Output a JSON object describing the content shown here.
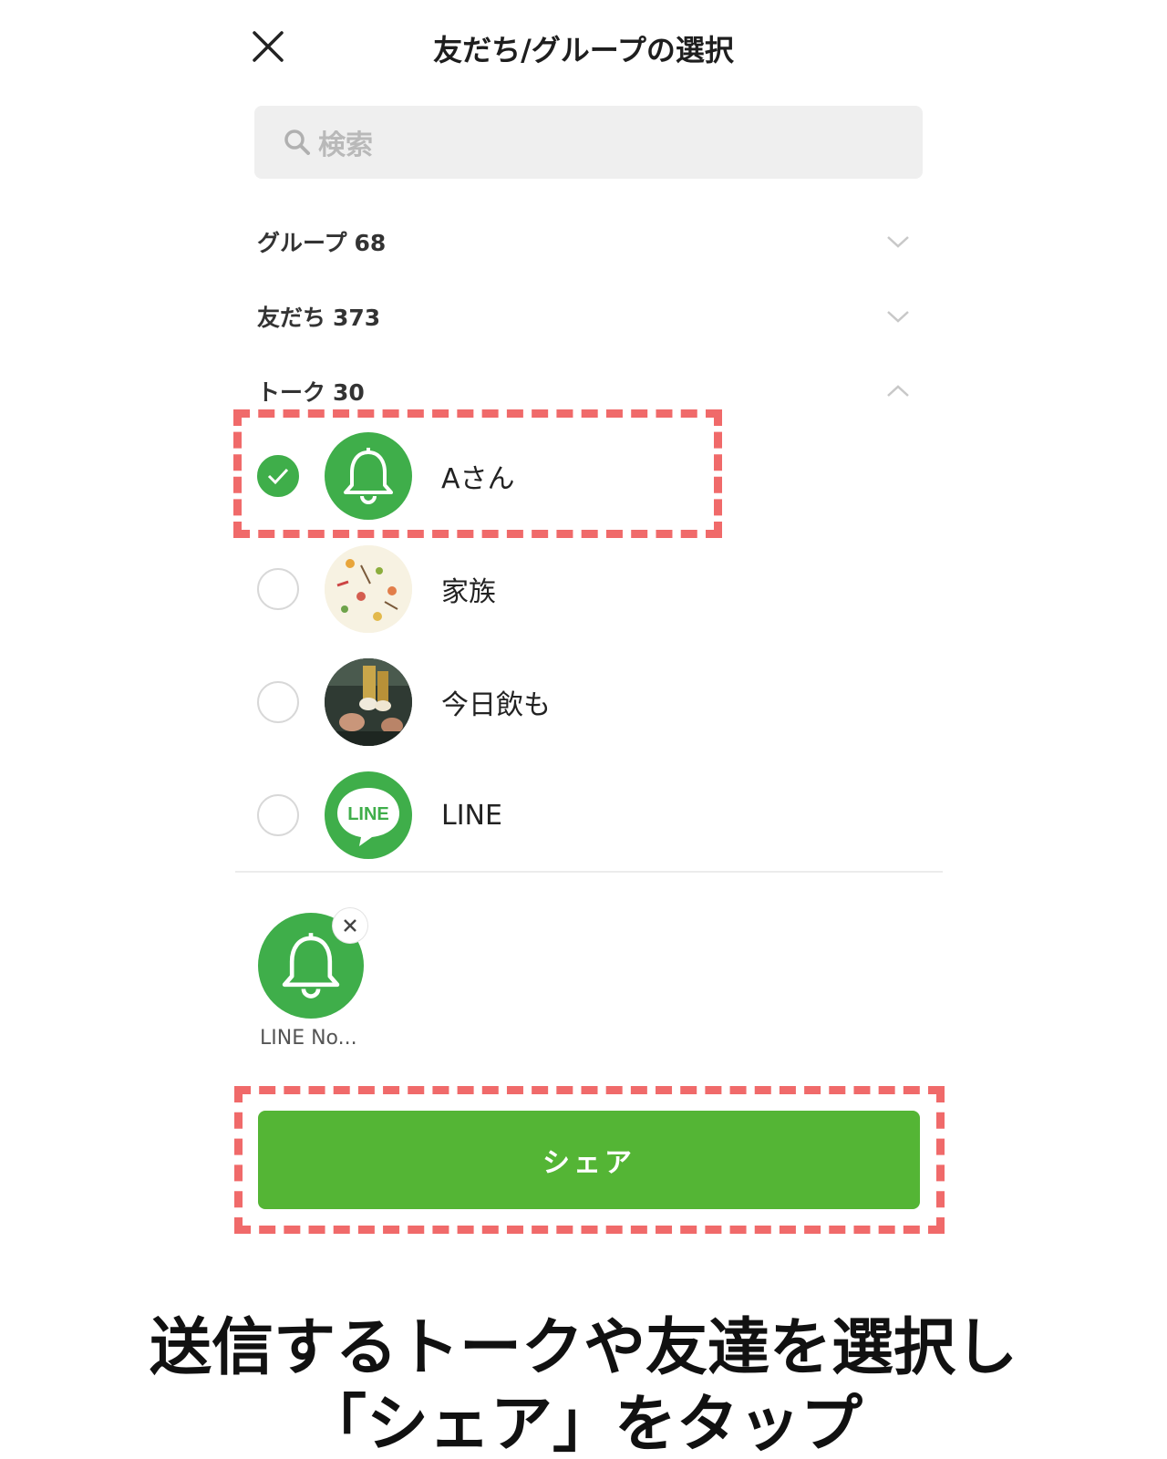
{
  "header": {
    "title": "友だち/グループの選択",
    "close_icon": "close-icon"
  },
  "search": {
    "placeholder": "検索",
    "icon": "search-icon"
  },
  "sections": [
    {
      "label": "グループ",
      "count": "68",
      "state": "collapsed"
    },
    {
      "label": "友だち",
      "count": "373",
      "state": "collapsed"
    },
    {
      "label": "トーク",
      "count": "30",
      "state": "expanded"
    }
  ],
  "talk_list": [
    {
      "name": "Aさん",
      "checked": true,
      "avatar": "bell-icon"
    },
    {
      "name": "家族",
      "checked": false,
      "avatar": "pattern-image"
    },
    {
      "name": "今日飲も",
      "checked": false,
      "avatar": "drinks-photo"
    },
    {
      "name": "LINE",
      "checked": false,
      "avatar": "line-logo"
    }
  ],
  "line_logo_text": "LINE",
  "selected": {
    "label": "LINE No...",
    "avatar": "bell-icon",
    "remove_icon": "remove-icon"
  },
  "share_button": {
    "label": "シェア"
  },
  "caption": {
    "line1": "送信するトークや友達を選択し",
    "line2": "「シェア」をタップ"
  },
  "colors": {
    "accent_green": "#3fae4a",
    "button_green": "#54b535",
    "highlight_red": "#f06a6a"
  }
}
